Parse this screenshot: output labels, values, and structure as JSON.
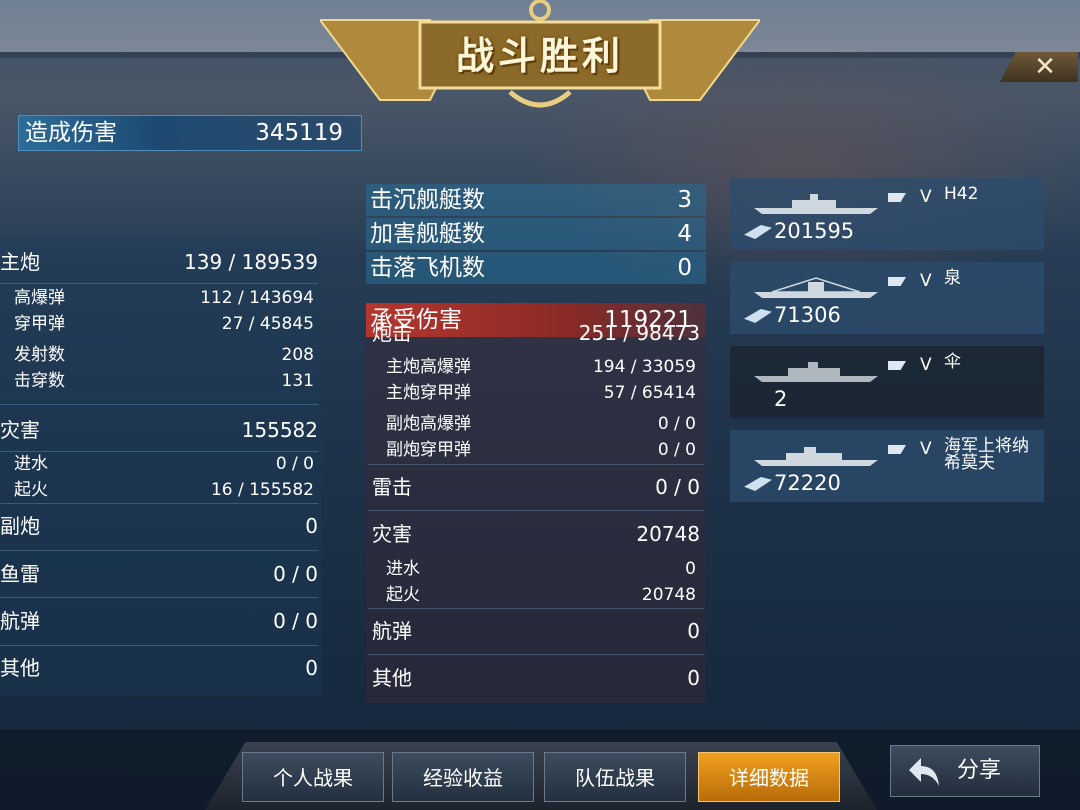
{
  "header": {
    "title": "战斗胜利",
    "close_label": "✕"
  },
  "damage_dealt": {
    "label": "造成伤害",
    "value": "345119"
  },
  "left_stats": {
    "main_gun": {
      "label": "主炮",
      "value": "139 / 189539"
    },
    "he": {
      "label": "高爆弹",
      "value": "112 / 143694"
    },
    "ap": {
      "label": "穿甲弹",
      "value": "27 / 45845"
    },
    "shots": {
      "label": "发射数",
      "value": "208"
    },
    "pens": {
      "label": "击穿数",
      "value": "131"
    },
    "disaster": {
      "label": "灾害",
      "value": "155582"
    },
    "flood": {
      "label": "进水",
      "value": "0 / 0"
    },
    "fire": {
      "label": "起火",
      "value": "16 / 155582"
    },
    "secondary": {
      "label": "副炮",
      "value": "0"
    },
    "torpedo": {
      "label": "鱼雷",
      "value": "0 / 0"
    },
    "bomb": {
      "label": "航弹",
      "value": "0 / 0"
    },
    "other": {
      "label": "其他",
      "value": "0"
    }
  },
  "kills": [
    {
      "label": "击沉舰艇数",
      "value": "3"
    },
    {
      "label": "加害舰艇数",
      "value": "4"
    },
    {
      "label": "击落飞机数",
      "value": "0"
    }
  ],
  "damage_received": {
    "label": "承受伤害",
    "value": "119221"
  },
  "mid_stats": {
    "gun": {
      "label": "炮击",
      "value": "251 / 98473"
    },
    "main_he": {
      "label": "主炮高爆弹",
      "value": "194 / 33059"
    },
    "main_ap": {
      "label": "主炮穿甲弹",
      "value": "57 / 65414"
    },
    "sec_he": {
      "label": "副炮高爆弹",
      "value": "0 / 0"
    },
    "sec_ap": {
      "label": "副炮穿甲弹",
      "value": "0 / 0"
    },
    "torpedo": {
      "label": "雷击",
      "value": "0 / 0"
    },
    "disaster": {
      "label": "灾害",
      "value": "20748"
    },
    "flood": {
      "label": "进水",
      "value": "0"
    },
    "fire": {
      "label": "起火",
      "value": "20748"
    },
    "bomb": {
      "label": "航弹",
      "value": "0"
    },
    "other": {
      "label": "其他",
      "value": "0"
    }
  },
  "ships": [
    {
      "tier": "V",
      "name": "H42",
      "score": "201595",
      "highlight": true
    },
    {
      "tier": "V",
      "name": "泉",
      "score": "71306",
      "highlight": true
    },
    {
      "tier": "V",
      "name": "伞",
      "score": "2",
      "highlight": false
    },
    {
      "tier": "V",
      "name": "海军上将纳希莫夫",
      "score": "72220",
      "highlight": true
    }
  ],
  "tabs": [
    {
      "label": "个人战果",
      "active": false
    },
    {
      "label": "经验收益",
      "active": false
    },
    {
      "label": "队伍战果",
      "active": false
    },
    {
      "label": "详细数据",
      "active": true
    }
  ],
  "share_label": "分享",
  "colors": {
    "accent_gold": "#f0a020",
    "received_red": "#b4362e",
    "dealt_blue": "#2d6d9a"
  }
}
